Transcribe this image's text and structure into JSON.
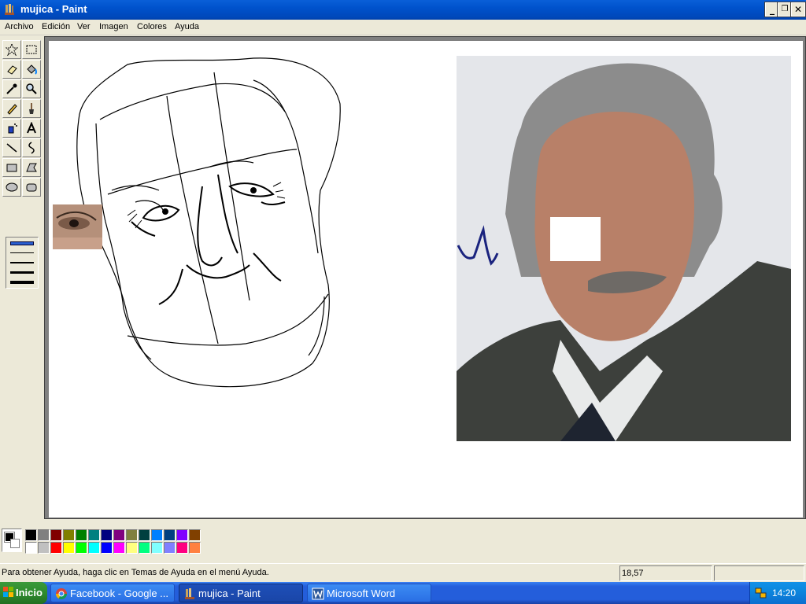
{
  "window": {
    "title": "mujica - Paint",
    "minimize": "_",
    "restore": "❐",
    "close": "✕"
  },
  "menu": [
    "Archivo",
    "Edición",
    "Ver",
    "Imagen",
    "Colores",
    "Ayuda"
  ],
  "tools": [
    {
      "name": "free-select-tool",
      "icon": "star-select-icon"
    },
    {
      "name": "rect-select-tool",
      "icon": "rect-select-icon"
    },
    {
      "name": "eraser-tool",
      "icon": "eraser-icon"
    },
    {
      "name": "fill-tool",
      "icon": "bucket-icon"
    },
    {
      "name": "color-picker-tool",
      "icon": "eyedropper-icon"
    },
    {
      "name": "magnifier-tool",
      "icon": "magnifier-icon"
    },
    {
      "name": "pencil-tool",
      "icon": "pencil-icon"
    },
    {
      "name": "brush-tool",
      "icon": "brush-icon"
    },
    {
      "name": "airbrush-tool",
      "icon": "spray-icon"
    },
    {
      "name": "text-tool",
      "icon": "text-A-icon"
    },
    {
      "name": "line-tool",
      "icon": "line-icon"
    },
    {
      "name": "curve-tool",
      "icon": "curve-icon"
    },
    {
      "name": "rectangle-tool",
      "icon": "rectangle-icon"
    },
    {
      "name": "polygon-tool",
      "icon": "polygon-icon"
    },
    {
      "name": "ellipse-tool",
      "icon": "ellipse-icon"
    },
    {
      "name": "rounded-rect-tool",
      "icon": "rounded-rect-icon"
    }
  ],
  "palette": {
    "foreground": "#000000",
    "background": "#ffffff",
    "row1": [
      "#000000",
      "#808080",
      "#800000",
      "#808000",
      "#008000",
      "#008080",
      "#000080",
      "#800080",
      "#808040",
      "#004040",
      "#0080ff",
      "#004080",
      "#8000ff",
      "#804000"
    ],
    "row2": [
      "#ffffff",
      "#c0c0c0",
      "#ff0000",
      "#ffff00",
      "#00ff00",
      "#00ffff",
      "#0000ff",
      "#ff00ff",
      "#ffff80",
      "#00ff80",
      "#80ffff",
      "#8080ff",
      "#ff0080",
      "#ff8040"
    ]
  },
  "status": {
    "help_text": "Para obtener Ayuda, haga clic en Temas de Ayuda en el menú Ayuda.",
    "coords": "18,57",
    "size": ""
  },
  "taskbar": {
    "start_label": "Inicio",
    "tasks": [
      {
        "label": "Facebook - Google ...",
        "icon": "chrome-icon",
        "active": false
      },
      {
        "label": "mujica - Paint",
        "icon": "paint-icon",
        "active": true
      },
      {
        "label": "Microsoft Word",
        "icon": "word-icon",
        "active": false
      }
    ],
    "clock": "14:20"
  }
}
